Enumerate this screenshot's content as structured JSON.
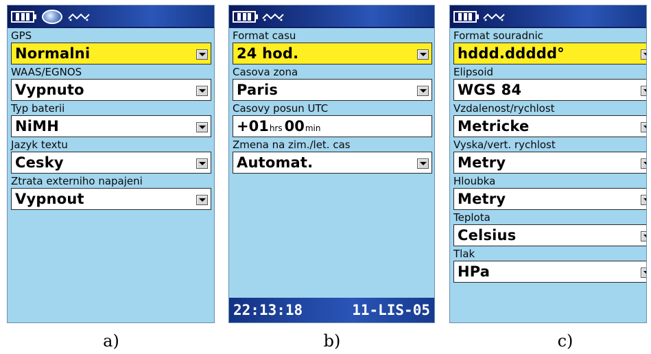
{
  "colors": {
    "screen_bg": "#a2d5ee",
    "selected_field": "#ffee22",
    "bar_blue": "#1b3a8e",
    "text": "#000000"
  },
  "icons": {
    "battery": "battery-icon",
    "satellite": "satellite-globe-icon",
    "signal": "signal-wave-icon",
    "dropdown": "dropdown-arrow-icon"
  },
  "panel_a": {
    "caption": "a)",
    "gps_label": "GPS",
    "gps_value": "Normalni",
    "waas_label": "WAAS/EGNOS",
    "waas_value": "Vypnuto",
    "battery_label": "Typ baterii",
    "battery_value": "NiMH",
    "language_label": "Jazyk textu",
    "language_value": "Cesky",
    "power_label": "Ztrata externiho napajeni",
    "power_value": "Vypnout"
  },
  "panel_b": {
    "caption": "b)",
    "time_format_label": "Format casu",
    "time_format_value": "24 hod.",
    "timezone_label": "Casova zona",
    "timezone_value": "Paris",
    "utc_offset_label": "Casovy posun UTC",
    "utc_hours": "+01",
    "utc_hours_unit": "hrs",
    "utc_minutes": "00",
    "utc_minutes_unit": "min",
    "dst_label": "Zmena na zim./let. cas",
    "dst_value": "Automat.",
    "status_time": "22:13:18",
    "status_date": "11-LIS-05"
  },
  "panel_c": {
    "caption": "c)",
    "coord_format_label": "Format souradnic",
    "coord_format_value": "hddd.ddddd°",
    "datum_label": "Elipsoid",
    "datum_value": "WGS 84",
    "distance_label": "Vzdalenost/rychlost",
    "distance_value": "Metricke",
    "elevation_label": "Vyska/vert. rychlost",
    "elevation_value": "Metry",
    "depth_label": "Hloubka",
    "depth_value": "Metry",
    "temperature_label": "Teplota",
    "temperature_value": "Celsius",
    "pressure_label": "Tlak",
    "pressure_value": "HPa"
  }
}
